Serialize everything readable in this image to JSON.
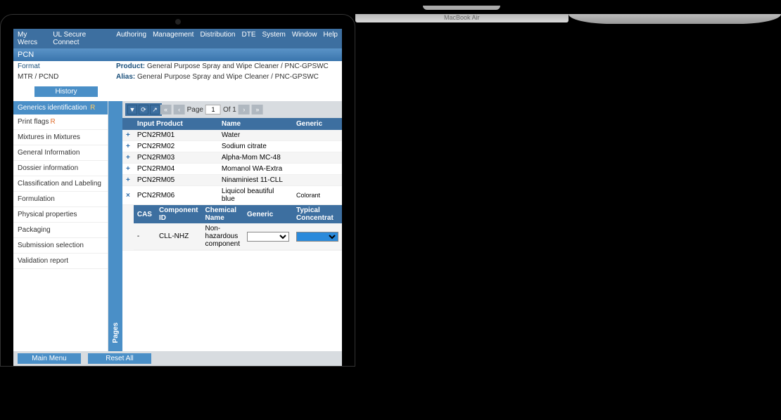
{
  "menu": [
    "My Wercs",
    "UL Secure Connect",
    "Authoring",
    "Management",
    "Distribution",
    "DTE",
    "System",
    "Window",
    "Help"
  ],
  "subheader": "PCN",
  "meta": {
    "format_label": "Format",
    "format_value": "MTR / PCND",
    "product_label": "Product:",
    "product_value": "General Purpose Spray and Wipe Cleaner / PNC-GPSWC",
    "alias_label": "Alias:",
    "alias_value": "General Purpose Spray and Wipe Cleaner / PNC-GPSWC"
  },
  "history_btn": "History",
  "sidebar": {
    "header": "Generics identification",
    "header_flag": "R",
    "items": [
      {
        "label": "Print flags",
        "flag": "R"
      },
      {
        "label": "Mixtures in Mixtures",
        "flag": ""
      },
      {
        "label": "General Information",
        "flag": ""
      },
      {
        "label": "Dossier information",
        "flag": ""
      },
      {
        "label": "Classification and Labeling",
        "flag": ""
      },
      {
        "label": "Formulation",
        "flag": ""
      },
      {
        "label": "Physical properties",
        "flag": ""
      },
      {
        "label": "Packaging",
        "flag": ""
      },
      {
        "label": "Submission selection",
        "flag": ""
      },
      {
        "label": "Validation report",
        "flag": ""
      }
    ]
  },
  "pages_tab": "Pages",
  "pager": {
    "page_label": "Page",
    "page_value": "1",
    "of_label": "Of 1"
  },
  "table": {
    "headers": [
      "",
      "Input Product",
      "Name",
      "Generic"
    ],
    "rows": [
      {
        "icon": "+",
        "input": "PCN2RM01",
        "name": "Water",
        "generic": ""
      },
      {
        "icon": "+",
        "input": "PCN2RM02",
        "name": "Sodium citrate",
        "generic": ""
      },
      {
        "icon": "+",
        "input": "PCN2RM03",
        "name": "Alpha-Mom MC-48",
        "generic": ""
      },
      {
        "icon": "+",
        "input": "PCN2RM04",
        "name": "Momanol WA-Extra",
        "generic": ""
      },
      {
        "icon": "+",
        "input": "PCN2RM05",
        "name": "Ninaminiest 11-CLL",
        "generic": ""
      },
      {
        "icon": "×",
        "input": "PCN2RM06",
        "name": "Liquicol beautiful blue",
        "generic": "Colorant"
      }
    ],
    "sub_headers": [
      "CAS",
      "Component ID",
      "Chemical Name",
      "Generic",
      "Typical Concentrat"
    ],
    "sub_row": {
      "cas": "-",
      "comp": "CLL-NHZ",
      "chem": "Non-hazardous component"
    }
  },
  "footer": {
    "main_menu": "Main Menu",
    "reset_all": "Reset All"
  }
}
